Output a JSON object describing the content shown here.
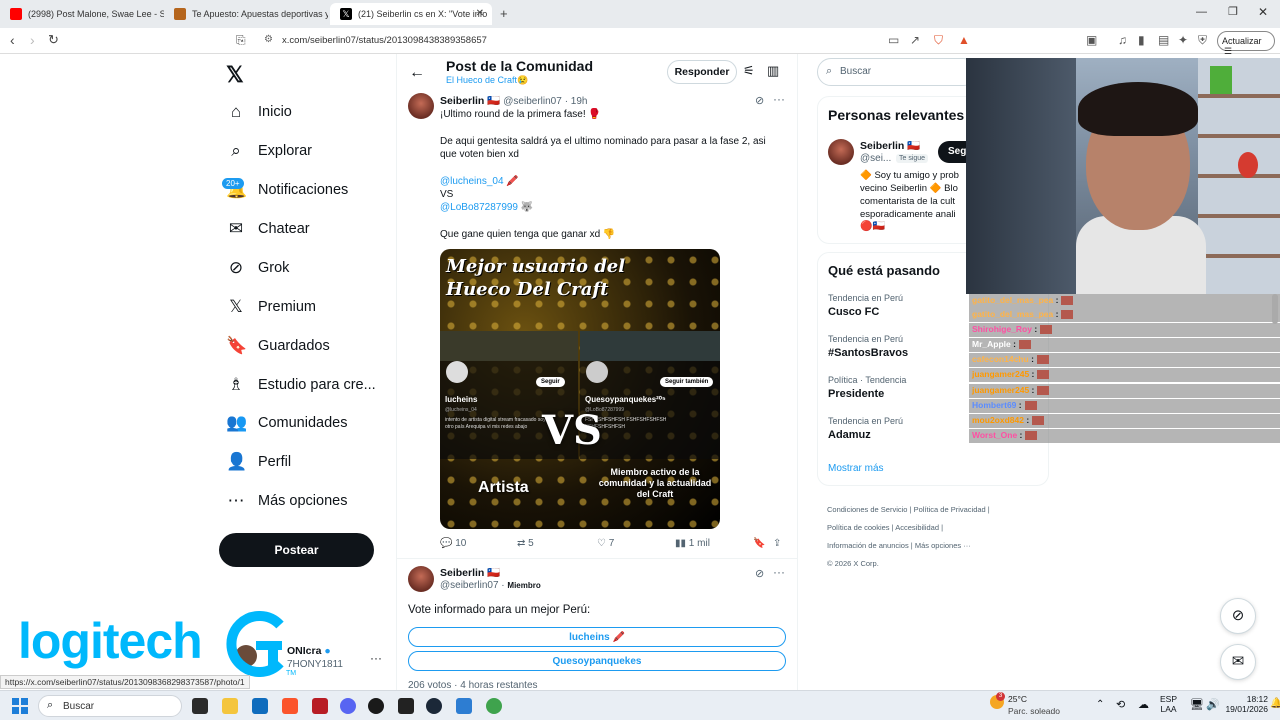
{
  "browser": {
    "tabs": [
      {
        "title": "(2998) Post Malone, Swae Lee - Sunfl",
        "favicon_color": "#ff0000"
      },
      {
        "title": "Te Apuesto: Apuestas deportivas y C",
        "favicon_color": "#b5651d"
      },
      {
        "title": "(21) Seiberlin cs en X: \"Vote info",
        "favicon_color": "#000000"
      }
    ],
    "url": "x.com/seiberlin07/status/2013098438389358657",
    "update_label": "Actualizar",
    "status_url": "https://x.com/seiberlin07/status/2013098368298373587/photo/1"
  },
  "nav": {
    "items": [
      {
        "label": "Inicio",
        "icon": "home-icon",
        "glyph": "⌂"
      },
      {
        "label": "Explorar",
        "icon": "search-icon",
        "glyph": "⌕"
      },
      {
        "label": "Notificaciones",
        "icon": "bell-icon",
        "glyph": "🔔"
      },
      {
        "label": "Chatear",
        "icon": "mail-icon",
        "glyph": "✉"
      },
      {
        "label": "Grok",
        "icon": "grok-icon",
        "glyph": "⊘"
      },
      {
        "label": "Premium",
        "icon": "x-logo-icon",
        "glyph": "𝕏"
      },
      {
        "label": "Guardados",
        "icon": "bookmark-icon",
        "glyph": "🔖"
      },
      {
        "label": "Estudio para cre...",
        "icon": "studio-icon",
        "glyph": "♗"
      },
      {
        "label": "Comunidades",
        "icon": "people-icon",
        "glyph": "👥"
      },
      {
        "label": "Perfil",
        "icon": "person-icon",
        "glyph": "👤"
      },
      {
        "label": "Más opciones",
        "icon": "more-circle-icon",
        "glyph": "⋯"
      }
    ],
    "notif_badge": "20+",
    "post_button": "Postear",
    "account_name": "ONIcra",
    "account_handle": "7HONY1811"
  },
  "header": {
    "title": "Post de la Comunidad",
    "subtitle": "El Hueco de Craft😢",
    "reply_button": "Responder"
  },
  "post1": {
    "name": "Seiberlin 🇨🇱",
    "handle": "@seiberlin07",
    "time": "· 19h",
    "lines": [
      "¡Ultimo round de la primera fase! 🥊",
      "De aqui gentesita saldrá ya el ultimo nominado para pasar a la fase 2, asi que voten bien xd",
      "@lucheins_04 🖍️",
      "VS",
      "@LoBo87287999 🐺",
      "Que gane quien tenga que ganar xd 👎"
    ],
    "image": {
      "headline": "Mejor usuario del Hueco Del Craft",
      "left_user": "lucheins",
      "left_bio": "intento de artista digital stream fracasado soy de otro país Arequipa vi mis redes abajo",
      "left_handle": "@lucheins_04",
      "left_follow": "Seguir",
      "right_user": "Quesoypanquekes²⁰⁵",
      "right_handle": "@LoBo87287999",
      "right_follow": "Seguir también",
      "right_bio": "FSHFSHFSHFSH FSHFSHFSHFSH FSHFSHFSHFSH",
      "vs": "VS",
      "left_caption": "Artista",
      "right_caption": "Miembro activo de la comunidad y la actualidad del Craft"
    },
    "stats": {
      "replies": "10",
      "reposts": "5",
      "likes": "7",
      "views": "1 mil"
    }
  },
  "post2": {
    "name": "Seiberlin 🇨🇱",
    "handle": "@seiberlin07",
    "badge": "Miembro",
    "text": "Vote informado para un mejor Perú:",
    "options": [
      "lucheins 🖍️",
      "Quesoypanquekes"
    ],
    "votes": "206 votos · 4 horas restantes"
  },
  "right": {
    "search_placeholder": "Buscar",
    "relevant_title": "Personas relevantes",
    "relevant_name": "Seiberlin 🇨🇱",
    "relevant_handle": "@sei...",
    "follows_you": "Te sigue",
    "follow_btn": "Seg",
    "relevant_bio": "🔶 Soy tu amigo y prob vecino Seiberlin 🔶 Blo comentarista de la cult esporadicamente anali",
    "relevant_flags": "🔴🇨🇱",
    "trends_title": "Qué está pasando",
    "trends": [
      {
        "cat": "Tendencia en Perú",
        "name": "Cusco FC"
      },
      {
        "cat": "Tendencia en Perú",
        "name": "#SantosBravos"
      },
      {
        "cat": "Política · Tendencia",
        "name": "Presidente"
      },
      {
        "cat": "Tendencia en Perú",
        "name": "Adamuz"
      }
    ],
    "show_more": "Mostrar más",
    "footer": [
      "Condiciones de Servicio",
      "Política de Privacidad",
      "Política de cookies",
      "Accesibilidad",
      "Información de anuncios",
      "Más opciones ···",
      "© 2026 X Corp."
    ]
  },
  "chat": [
    {
      "user": "gatito_del_mas_pea",
      "color": "#ffb347"
    },
    {
      "user": "gatito_del_mas_pea",
      "color": "#ffb347"
    },
    {
      "user": "Shirohige_Roy",
      "color": "#ff4fa3"
    },
    {
      "user": "Mr_Apple",
      "color": "#ffffff"
    },
    {
      "user": "cafecon14chu",
      "color": "#ffb347"
    },
    {
      "user": "juangamer245",
      "color": "#ff9900"
    },
    {
      "user": "juangamer245",
      "color": "#ff9900"
    },
    {
      "user": "Hombert69",
      "color": "#5b8cff"
    },
    {
      "user": "mou2oxd842",
      "color": "#ff9900"
    },
    {
      "user": "Worst_One",
      "color": "#ff4fa3"
    }
  ],
  "overlay": {
    "brand": "logitech",
    "tm": "TM"
  },
  "taskbar": {
    "search": "Buscar",
    "weather_temp": "25°C",
    "weather_desc": "Parc. soleado",
    "weather_badge": "3",
    "lang": "ESP",
    "lang2": "LAA",
    "time": "18:12",
    "date": "19/01/2026"
  }
}
